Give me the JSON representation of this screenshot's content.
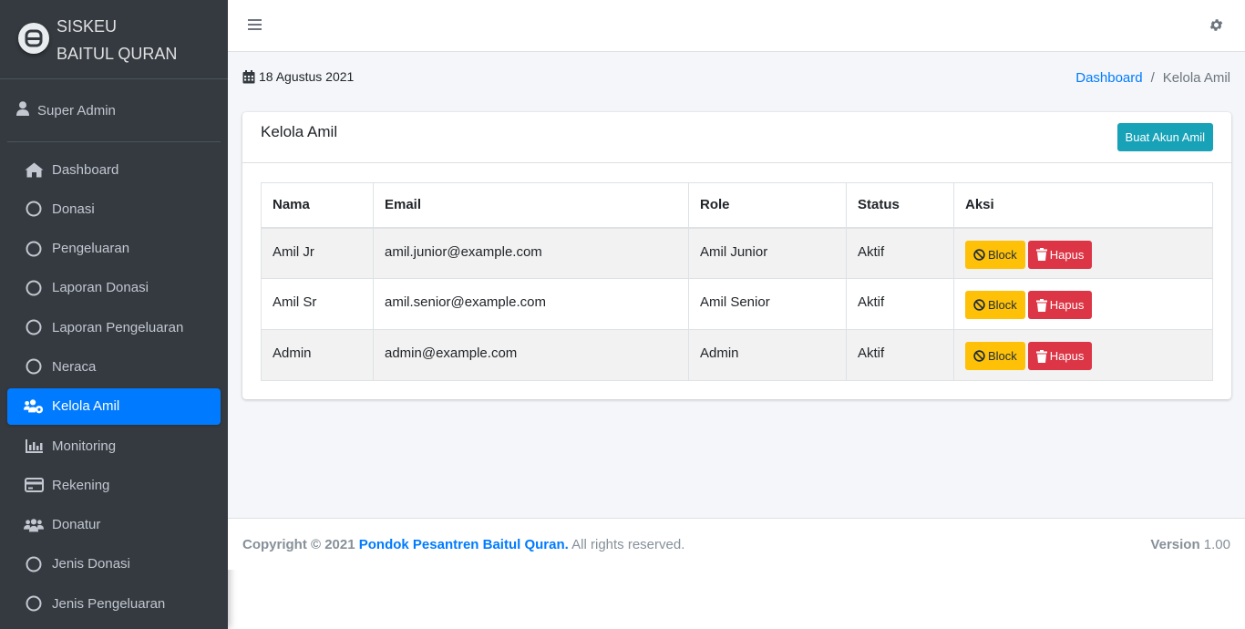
{
  "brand": {
    "line1": "SISKEU",
    "line2": "BAITUL QURAN",
    "logo_icon": "brand-logo-icon"
  },
  "user": {
    "name": "Super Admin",
    "icon": "user-icon"
  },
  "sidebar": {
    "items": [
      {
        "label": "Dashboard",
        "icon": "home-icon"
      },
      {
        "label": "Donasi",
        "icon": "circle-icon"
      },
      {
        "label": "Pengeluaran",
        "icon": "circle-icon"
      },
      {
        "label": "Laporan Donasi",
        "icon": "circle-icon"
      },
      {
        "label": "Laporan Pengeluaran",
        "icon": "circle-icon"
      },
      {
        "label": "Neraca",
        "icon": "circle-icon"
      },
      {
        "label": "Kelola Amil",
        "icon": "users-cog-icon",
        "active": true
      },
      {
        "label": "Monitoring",
        "icon": "chart-bar-icon"
      },
      {
        "label": "Rekening",
        "icon": "credit-card-icon"
      },
      {
        "label": "Donatur",
        "icon": "users-icon"
      },
      {
        "label": "Jenis Donasi",
        "icon": "circle-icon"
      },
      {
        "label": "Jenis Pengeluaran",
        "icon": "circle-icon"
      }
    ]
  },
  "header": {
    "menu_icon": "hamburger-icon",
    "settings_icon": "gear-icon"
  },
  "content": {
    "date": "18 Agustus 2021",
    "breadcrumb": {
      "home": "Dashboard",
      "current": "Kelola Amil",
      "separator": "/"
    }
  },
  "card": {
    "title": "Kelola Amil",
    "create_button": "Buat Akun Amil"
  },
  "table": {
    "headers": [
      "Nama",
      "Email",
      "Role",
      "Status",
      "Aksi"
    ],
    "rows": [
      {
        "nama": "Amil Jr",
        "email": "amil.junior@example.com",
        "role": "Amil Junior",
        "status": "Aktif"
      },
      {
        "nama": "Amil Sr",
        "email": "amil.senior@example.com",
        "role": "Amil Senior",
        "status": "Aktif"
      },
      {
        "nama": "Admin",
        "email": "admin@example.com",
        "role": "Admin",
        "status": "Aktif"
      }
    ],
    "actions": {
      "block": "Block",
      "hapus": "Hapus"
    }
  },
  "footer": {
    "copyright": "Copyright © 2021",
    "org": "Pondok Pesantren Baitul Quran.",
    "rights": "All rights reserved.",
    "version_label": "Version",
    "version": "1.00"
  },
  "colors": {
    "sidebar_bg": "#343a40",
    "active": "#007bff",
    "info": "#17a2b8",
    "warning": "#ffc107",
    "danger": "#dc3545",
    "content_bg": "#f4f6f9"
  }
}
